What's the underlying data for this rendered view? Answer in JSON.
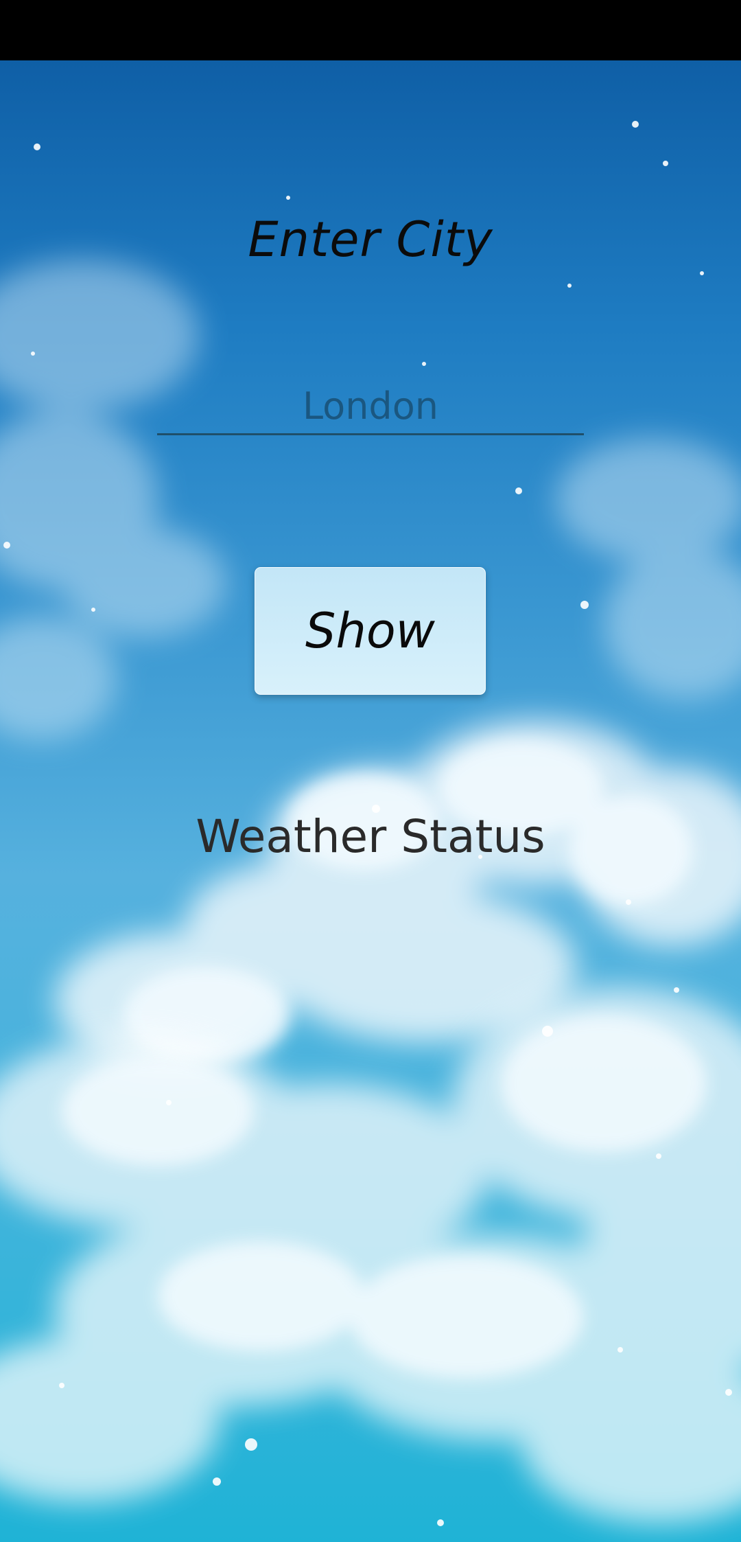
{
  "screen": {
    "title": "Enter City",
    "city_input": {
      "value": "",
      "placeholder": "London"
    },
    "show_button_label": "Show",
    "weather_status": "Weather Status"
  },
  "background": {
    "type": "sky-with-clouds",
    "top_color": "#0f5fa6",
    "bottom_color": "#1fb3d6"
  }
}
